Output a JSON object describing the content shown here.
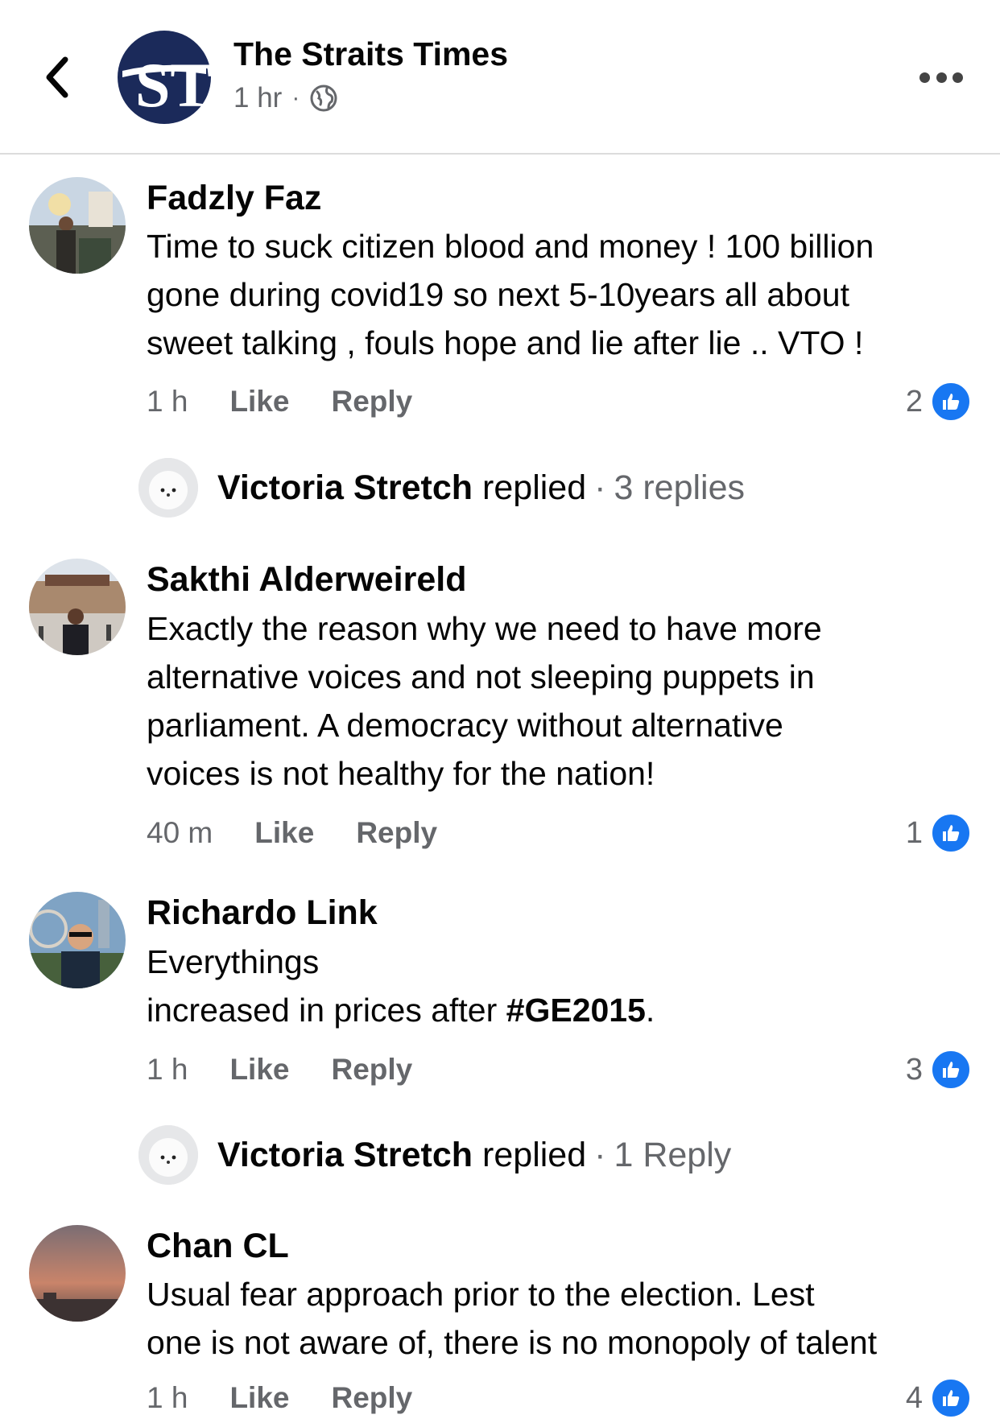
{
  "header": {
    "back_icon": "chevron-left-icon",
    "page_name": "The Straits Times",
    "logo_text": "ST",
    "post_time": "1 hr",
    "separator": "·",
    "privacy_icon": "globe-icon",
    "more_icon": "more-horizontal-icon"
  },
  "colors": {
    "like_blue": "#1877f2",
    "secondary_text": "#65676b",
    "logo_navy": "#1b2a5a"
  },
  "comments": [
    {
      "author": "Fadzly Faz",
      "lines": [
        "Time to suck citizen blood and money ! 100 billion",
        "gone during covid19 so next 5-10years all about",
        "sweet talking , fouls hope and lie after lie .. VTO !"
      ],
      "time": "1 h",
      "like_label": "Like",
      "reply_label": "Reply",
      "reaction_count": "2",
      "reply_preview": {
        "name": "Victoria Stretch",
        "verb": "replied",
        "separator": "·",
        "count": "3 replies"
      }
    },
    {
      "author": "Sakthi Alderweireld",
      "lines": [
        "Exactly the reason why we need to have more",
        "alternative voices and not sleeping puppets in",
        "parliament. A democracy without alternative",
        "voices is not healthy for the nation!"
      ],
      "time": "40 m",
      "like_label": "Like",
      "reply_label": "Reply",
      "reaction_count": "1"
    },
    {
      "author": "Richardo Link",
      "line1": "Everythings",
      "line2_prefix": "increased in prices after ",
      "hashtag": "#GE2015",
      "line2_suffix": ".",
      "time": "1 h",
      "like_label": "Like",
      "reply_label": "Reply",
      "reaction_count": "3",
      "reply_preview": {
        "name": "Victoria Stretch",
        "verb": "replied",
        "separator": "·",
        "count": "1 Reply"
      }
    },
    {
      "author": "Chan CL",
      "lines": [
        "Usual fear approach prior to the election. Lest",
        "one is not aware of, there is no monopoly of talent"
      ],
      "time": "1 h",
      "like_label": "Like",
      "reply_label": "Reply",
      "reaction_count": "4"
    }
  ]
}
